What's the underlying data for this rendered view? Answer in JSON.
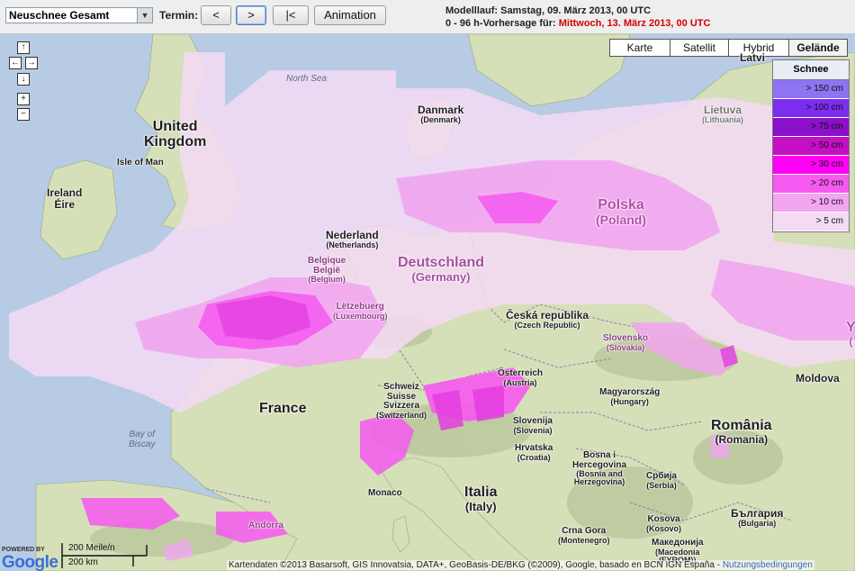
{
  "toolbar": {
    "parameter_select": "Neuschnee Gesamt",
    "termin_label": "Termin:",
    "btn_prev": "<",
    "btn_next": ">",
    "btn_first": "|<",
    "btn_animation": "Animation",
    "model_run": "Modelllauf: Samstag, 09. März 2013, 00 UTC",
    "forecast_prefix": "0 - 96 h-Vorhersage für: ",
    "forecast_date": "Mittwoch, 13. März 2013, 00 UTC"
  },
  "nav": {
    "up": "↑",
    "left": "←",
    "right": "→",
    "down": "↓",
    "zoom_in": "+",
    "zoom_out": "−"
  },
  "map_types": [
    "Karte",
    "Satellit",
    "Hybrid",
    "Gelände"
  ],
  "legend": {
    "title": "Schnee",
    "items": [
      {
        "label": "> 150 cm",
        "color": "#8e73f3"
      },
      {
        "label": "> 100 cm",
        "color": "#7c2df0"
      },
      {
        "label": "> 75 cm",
        "color": "#8a10c9"
      },
      {
        "label": "> 50 cm",
        "color": "#c40fc4"
      },
      {
        "label": "> 30 cm",
        "color": "#ff00f5"
      },
      {
        "label": "> 20 cm",
        "color": "#f659f0"
      },
      {
        "label": "> 10 cm",
        "color": "#f1a6ef"
      },
      {
        "label": "> 5 cm",
        "color": "#f5daf4"
      }
    ]
  },
  "labels": {
    "latvia": "Latvi",
    "lietuva": "Lietuva",
    "lithuania": "(Lithuania)",
    "north_sea": "North Sea",
    "denmark": "Danmark",
    "denmark_en": "(Denmark)",
    "uk1": "United",
    "uk2": "Kingdom",
    "isle_of_man": "Isle of Man",
    "ireland": "Ireland",
    "eire": "Éire",
    "nederland": "Nederland",
    "netherlands": "(Netherlands)",
    "polska": "Polska",
    "poland": "(Poland)",
    "deutschland": "Deutschland",
    "germany": "(Germany)",
    "belgique": "Belgique",
    "belgie": "België",
    "belgium": "(Belgium)",
    "letzebuerg": "Lëtzebuerg",
    "luxembourg": "(Luxembourg)",
    "ceska": "Česká republika",
    "czech": "(Czech Republic)",
    "slovensko": "Slovensko",
    "slovakia": "(Slovakia)",
    "france": "France",
    "schweiz1": "Schweiz",
    "schweiz2": "Suisse",
    "schweiz3": "Svizzera",
    "switzerland": "(Switzerland)",
    "osterreich": "Österreich",
    "austria": "(Austria)",
    "magyar": "Magyarország",
    "hungary": "(Hungary)",
    "moldova": "Moldova",
    "bay1": "Bay of",
    "bay2": "Biscay",
    "slovenija": "Slovenija",
    "slovenia": "(Slovenia)",
    "hrvatska": "Hrvatska",
    "croatia": "(Croatia)",
    "romania": "România",
    "romania_en": "(Romania)",
    "bosna1": "Bosna i",
    "bosna2": "Hercegovina",
    "bosna3": "(Bosnia and",
    "bosna4": "Herzegovina)",
    "srbija": "Србија",
    "serbia": "(Serbia)",
    "monaco": "Monaco",
    "italia": "Italia",
    "italy": "(Italy)",
    "crna_gora": "Crna Gora",
    "montenegro": "(Montenegro)",
    "kosovo": "Kosova",
    "kosovo2": "(Kosovo)",
    "bulgaria": "България",
    "bulgaria_en": "(Bulgaria)",
    "andorra": "Andorra",
    "makedonija": "Македонија",
    "makedonija2": "(Macedonia",
    "makedonija3": "(FYROM))",
    "y_edge": "Y",
    "r_edge": "("
  },
  "footer": {
    "powered_by": "POWERED BY",
    "google": "Google",
    "scale_miles": "200 Meile/n",
    "scale_km": "200 km",
    "attribution": "Kartendaten ©2013 Basarsoft, GIS Innovatsia, DATA+, GeoBasis-DE/BKG (©2009), Google, basado en BCN IGN España - ",
    "terms_link": "Nutzungsbedingungen"
  }
}
